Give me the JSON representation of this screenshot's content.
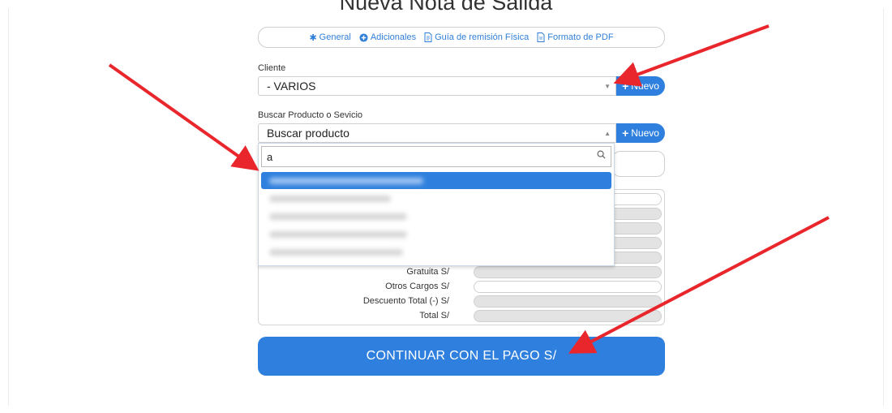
{
  "page": {
    "title": "Nueva Nota de Salida"
  },
  "tabs": [
    {
      "label": "General",
      "icon": "asterisk-icon"
    },
    {
      "label": "Adicionales",
      "icon": "plus-circle-icon"
    },
    {
      "label": "Guía de remisión Física",
      "icon": "document-icon"
    },
    {
      "label": "Formato de PDF",
      "icon": "pdf-icon"
    }
  ],
  "client": {
    "label": "Cliente",
    "value": "- VARIOS",
    "new_label": "Nuevo"
  },
  "product": {
    "label": "Buscar Producto o Sevicio",
    "value": "Buscar producto",
    "new_label": "Nuevo",
    "search_value": "a"
  },
  "totals": [
    {
      "label": "Gratuita S/"
    },
    {
      "label": "Otros Cargos S/"
    },
    {
      "label": "Descuento Total (-) S/"
    },
    {
      "label": "Total S/"
    }
  ],
  "continue_label": "CONTINUAR CON EL PAGO S/",
  "colors": {
    "accent": "#2f80de",
    "arrow": "#e8262b"
  }
}
